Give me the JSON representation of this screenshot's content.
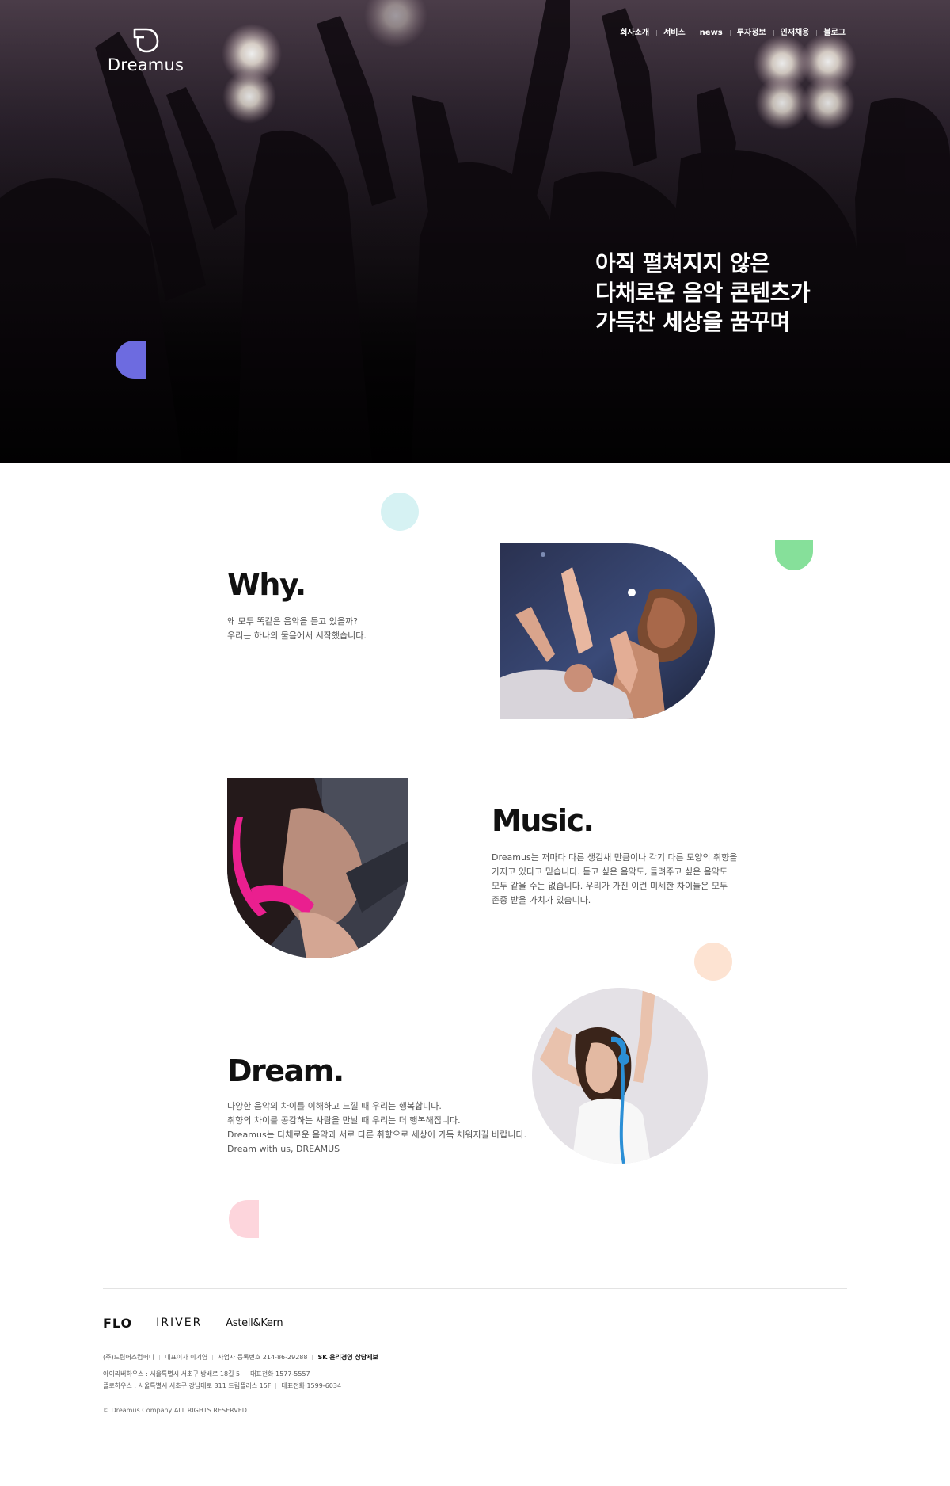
{
  "header": {
    "logo_text": "Dreamus",
    "nav": [
      "회사소개",
      "서비스",
      "news",
      "투자정보",
      "인재채용",
      "블로그"
    ]
  },
  "hero": {
    "headline": [
      "아직 펼쳐지지 않은",
      "다채로운 음악 콘텐츠가",
      "가득찬 세상을 꿈꾸며"
    ]
  },
  "sections": {
    "why": {
      "title": "Why.",
      "lines": [
        "왜 모두 똑같은 음악을 듣고 있을까?",
        "우리는 하나의 물음에서 시작했습니다."
      ]
    },
    "music": {
      "title": "Music.",
      "lines": [
        "Dreamus는 저마다 다른 생김새 만큼이나 각기 다른 모양의 취향을",
        "가지고 있다고 믿습니다. 듣고 싶은 음악도, 들려주고 싶은 음악도",
        "모두 같을 수는 없습니다. 우리가 가진 이런 미세한 차이들은 모두",
        "존중 받을 가치가 있습니다."
      ]
    },
    "dream": {
      "title": "Dream.",
      "lines": [
        "다양한 음악의 차이를 이해하고 느낄 때 우리는 행복합니다.",
        "취향의 차이를 공감하는 사람을 만날 때 우리는 더 행복해집니다.",
        "Dreamus는 다채로운 음악과 서로 다른 취향으로 세상이 가득 채워지길 바랍니다.",
        "Dream with us, DREAMUS"
      ]
    }
  },
  "footer": {
    "brands": [
      "FLO",
      "IRIVER",
      "Astell&Kern"
    ],
    "company": {
      "name": "(주)드림어스컴퍼니",
      "ceo": "대표이사 이기영",
      "biz_no": "사업자 등록번호 214-86-29288",
      "ethics": "SK 윤리경영 상담제보"
    },
    "address1": {
      "label": "아이리버하우스 : 서울특별시 서초구 방배로 18길 5",
      "tel": "대표전화 1577-5557"
    },
    "address2": {
      "label": "플로하우스 : 서울특별시 서초구 강남대로 311 드림플러스 15F",
      "tel": "대표전화 1599-6034"
    },
    "copyright": "© Dreamus Company ALL RIGHTS RESERVED."
  },
  "colors": {
    "hero_accent": "#6d6be0",
    "deco_cyan": "#d6f2f3",
    "deco_green": "#86e09a",
    "deco_peach": "#fde3d2",
    "deco_pink": "#fdd5dc"
  }
}
